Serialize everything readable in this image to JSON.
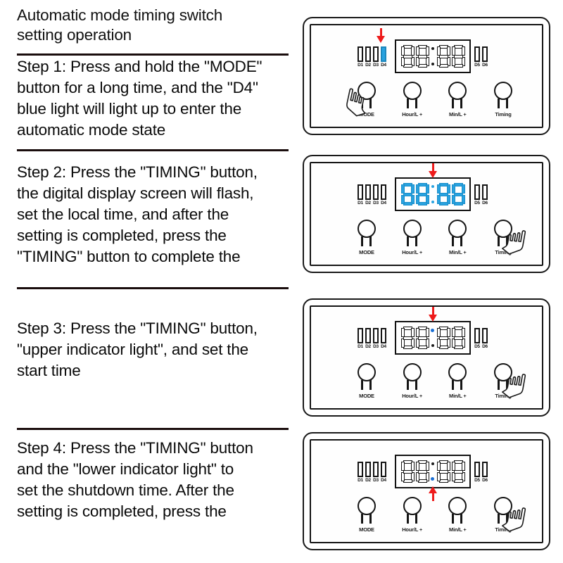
{
  "document": {
    "title_lines": [
      "Automatic mode timing switch",
      "setting operation"
    ],
    "accent_red": "#ee1b1b",
    "accent_blue": "#29a3e0",
    "indicator_blue": "#1a6fd4"
  },
  "steps": [
    {
      "id": "step-1",
      "lines": [
        "Step 1: Press and hold the \"MODE\"",
        "button for a long time, and the \"D4\"",
        "blue light will light up to enter the",
        "automatic mode state"
      ],
      "panel": {
        "left_leds": [
          {
            "label": "D1",
            "on": false
          },
          {
            "label": "D2",
            "on": false
          },
          {
            "label": "D3",
            "on": false
          },
          {
            "label": "D4",
            "on": true
          }
        ],
        "right_leds": [
          {
            "label": "D5",
            "on": false
          },
          {
            "label": "D6",
            "on": false
          }
        ],
        "display": {
          "digits": "8888",
          "lit": false,
          "colon_top": "off",
          "colon_bottom": "off"
        },
        "arrow": {
          "direction": "down",
          "target": "D4"
        },
        "buttons": [
          {
            "label": "MODE",
            "pressed": true
          },
          {
            "label": "Hour/L +",
            "pressed": false
          },
          {
            "label": "Min/L +",
            "pressed": false
          },
          {
            "label": "Timing",
            "pressed": false
          }
        ],
        "hand_target": "MODE"
      }
    },
    {
      "id": "step-2",
      "lines": [
        "Step 2: Press the \"TIMING\" button,",
        "the digital display screen will flash,",
        "set the local time, and after the",
        "setting is completed, press the",
        "\"TIMING\" button to complete the"
      ],
      "panel": {
        "left_leds": [
          {
            "label": "D1",
            "on": false
          },
          {
            "label": "D2",
            "on": false
          },
          {
            "label": "D3",
            "on": false
          },
          {
            "label": "D4",
            "on": false
          }
        ],
        "right_leds": [
          {
            "label": "D5",
            "on": false
          },
          {
            "label": "D6",
            "on": false
          }
        ],
        "display": {
          "digits": "8888",
          "lit": true,
          "colon_top": "cyan",
          "colon_bottom": "cyan"
        },
        "arrow": {
          "direction": "down",
          "target": "display"
        },
        "buttons": [
          {
            "label": "MODE",
            "pressed": false
          },
          {
            "label": "Hour/L +",
            "pressed": false
          },
          {
            "label": "Min/L +",
            "pressed": false
          },
          {
            "label": "Timing",
            "pressed": true
          }
        ],
        "hand_target": "Timing"
      }
    },
    {
      "id": "step-3",
      "lines": [
        "Step 3: Press the \"TIMING\" button,",
        "\"upper indicator light\", and set the",
        "start time"
      ],
      "panel": {
        "left_leds": [
          {
            "label": "D1",
            "on": false
          },
          {
            "label": "D2",
            "on": false
          },
          {
            "label": "D3",
            "on": false
          },
          {
            "label": "D4",
            "on": false
          }
        ],
        "right_leds": [
          {
            "label": "D5",
            "on": false
          },
          {
            "label": "D6",
            "on": false
          }
        ],
        "display": {
          "digits": "8888",
          "lit": false,
          "colon_top": "blue",
          "colon_bottom": "off"
        },
        "arrow": {
          "direction": "down",
          "target": "upper-indicator"
        },
        "buttons": [
          {
            "label": "MODE",
            "pressed": false
          },
          {
            "label": "Hour/L +",
            "pressed": false
          },
          {
            "label": "Min/L +",
            "pressed": false
          },
          {
            "label": "Timing",
            "pressed": true
          }
        ],
        "hand_target": "Timing"
      }
    },
    {
      "id": "step-4",
      "lines": [
        "Step 4: Press the \"TIMING\" button",
        "and the \"lower indicator light\" to",
        "set the shutdown time. After the",
        "setting is completed, press the"
      ],
      "panel": {
        "left_leds": [
          {
            "label": "D1",
            "on": false
          },
          {
            "label": "D2",
            "on": false
          },
          {
            "label": "D3",
            "on": false
          },
          {
            "label": "D4",
            "on": false
          }
        ],
        "right_leds": [
          {
            "label": "D5",
            "on": false
          },
          {
            "label": "D6",
            "on": false
          }
        ],
        "display": {
          "digits": "8888",
          "lit": false,
          "colon_top": "off",
          "colon_bottom": "blue"
        },
        "arrow": {
          "direction": "up",
          "target": "lower-indicator"
        },
        "buttons": [
          {
            "label": "MODE",
            "pressed": false
          },
          {
            "label": "Hour/L +",
            "pressed": false
          },
          {
            "label": "Min/L +",
            "pressed": false
          },
          {
            "label": "Timing",
            "pressed": true
          }
        ],
        "hand_target": "Timing"
      }
    }
  ]
}
